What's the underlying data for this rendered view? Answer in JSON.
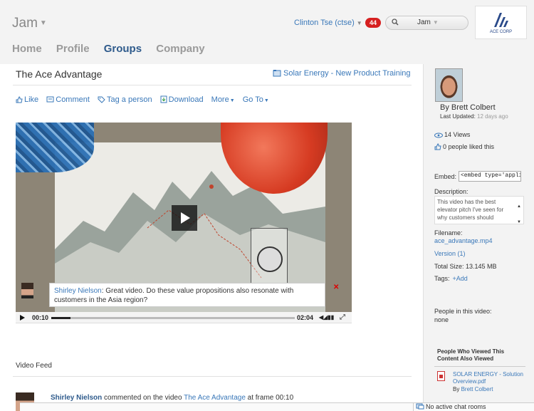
{
  "app": {
    "title": "Jam"
  },
  "header": {
    "user": "Clinton Tse (ctse)",
    "notifications": "44",
    "search_scope": "Jam",
    "logo_text": "ACE CORP"
  },
  "nav": {
    "items": [
      "Home",
      "Profile",
      "Groups",
      "Company"
    ],
    "active": "Groups"
  },
  "content": {
    "title": "The Ace Advantage",
    "related_link": "Solar Energy - New Product Training",
    "actions": {
      "like": "Like",
      "comment": "Comment",
      "tag": "Tag a person",
      "download": "Download",
      "more": "More",
      "goto": "Go To"
    }
  },
  "video": {
    "comment_author": "Shirley Nielson",
    "comment_text": ": Great video. Do these value propositions also resonate with customers in the Asia region?",
    "current_time": "00:10",
    "duration": "02:04",
    "progress": 0.08
  },
  "feed": {
    "label": "Video Feed",
    "entry_author": "Shirley Nielson",
    "entry_text": " commented on the video ",
    "entry_link": "The Ace Advantage",
    "entry_suffix": " at frame 00:10"
  },
  "sidebar": {
    "author": "By Brett Colbert",
    "updated_label": "Last Updated:",
    "updated_ago": "12 days ago",
    "views": "14 Views",
    "likes": "0 people liked this",
    "embed_label": "Embed:",
    "embed_value": "<embed type='applic",
    "description_label": "Description:",
    "description": "This video has the best elevator pitch I've seen for why customers should",
    "filename_label": "Filename:",
    "filename": "ace_advantage.mp4",
    "version": "Version (1)",
    "total_size": "Total Size: 13.145 MB",
    "tags_label": "Tags:",
    "tags_add": "+Add",
    "people_label": "People in this video:",
    "people_value": "none",
    "also_viewed_label": "People Who Viewed This Content Also Viewed",
    "also_viewed_item": "SOLAR ENERGY - Solution Overview.pdf",
    "also_viewed_by_prefix": "By ",
    "also_viewed_by": "Brett Colbert"
  },
  "chat": {
    "status": "No active chat rooms"
  },
  "colors": {
    "link": "#3a78b9",
    "nav_active": "#2f5b8c",
    "badge": "#d62020",
    "sidebar_bg": "#f3f3f3"
  }
}
